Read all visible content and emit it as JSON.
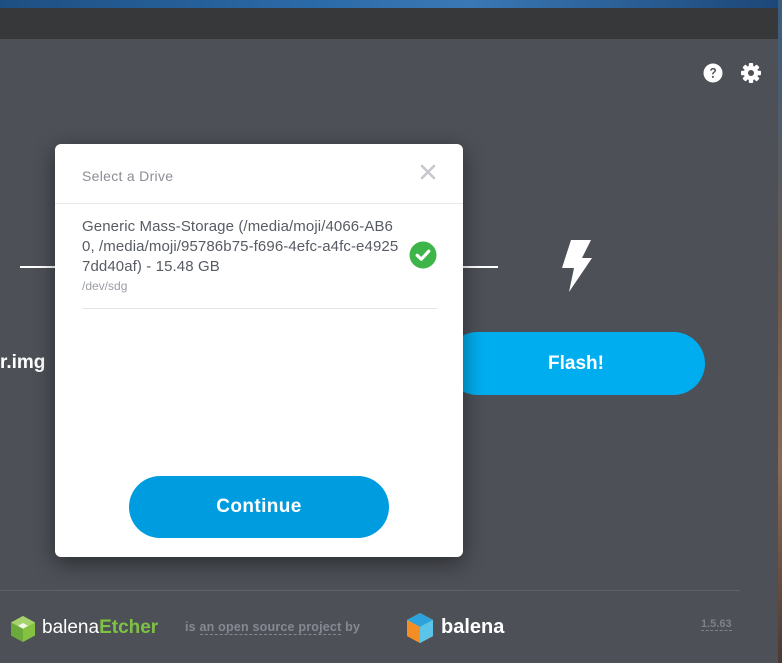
{
  "header": {
    "help_icon": "help-circle-icon",
    "settings_icon": "gear-icon"
  },
  "main": {
    "image_name": "r.img",
    "flash_icon": "lightning-icon",
    "flash_label": "Flash!"
  },
  "modal": {
    "title": "Select a Drive",
    "close_icon": "close-icon",
    "drives": [
      {
        "description": "Generic Mass-Storage (/media/moji/4066-AB60, /media/moji/95786b75-f696-4efc-a4fc-e49257dd40af) - 15.48 GB",
        "path": "/dev/sdg",
        "selected": true
      }
    ],
    "continue_label": "Continue"
  },
  "footer": {
    "brand_prefix": "balena",
    "brand_suffix": "Etcher",
    "oss_is": "is",
    "oss_link": "an open source project",
    "oss_by": "by",
    "company": "balena",
    "version": "1.5.63"
  },
  "colors": {
    "app_background": "#4d5057",
    "accent_blue": "#00aeef",
    "continue_blue": "#009ce0",
    "success_green": "#3eb549",
    "etcher_green": "#7ec242"
  }
}
